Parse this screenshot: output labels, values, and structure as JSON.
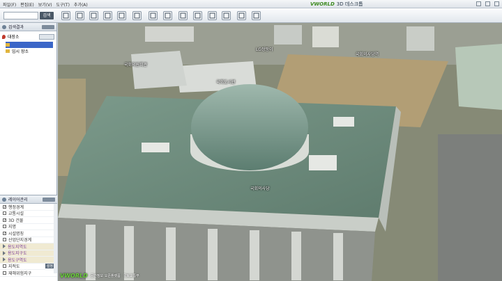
{
  "window": {
    "title": "3D 데스크톱",
    "brand": "WORLD"
  },
  "menu": [
    "파일(F)",
    "편집(E)",
    "보기(V)",
    "도구(T)",
    "추가(A)"
  ],
  "toolbar": {
    "search_placeholder": "",
    "search_button": "검색",
    "tools": [
      "home-icon",
      "measure-icon",
      "terrain-icon",
      "building-icon",
      "house-icon",
      "globe-icon",
      "table-icon",
      "image-icon",
      "chart-icon",
      "bookmark-icon",
      "eye-icon",
      "print-icon",
      "document-icon",
      "refresh-icon"
    ]
  },
  "search_panel": {
    "header": "검색결과",
    "tab_label": "대장소",
    "tree": [
      {
        "label": "",
        "selected": true
      },
      {
        "label": "임시 장소",
        "selected": false
      }
    ]
  },
  "layer_panel": {
    "header": "레이어관리",
    "items": [
      {
        "label": "행정경계",
        "checked": true,
        "group": false
      },
      {
        "label": "교통시설",
        "checked": false,
        "group": false
      },
      {
        "label": "3D 건물",
        "checked": true,
        "group": false
      },
      {
        "label": "지명",
        "checked": false,
        "group": false
      },
      {
        "label": "시설명칭",
        "checked": true,
        "group": false
      },
      {
        "label": "산업단지경계",
        "checked": false,
        "group": false
      },
      {
        "label": "용도지역도",
        "checked": false,
        "group": true
      },
      {
        "label": "용도지구도",
        "checked": false,
        "group": true
      },
      {
        "label": "용도구역도",
        "checked": false,
        "group": true
      },
      {
        "label": "지적도",
        "checked": false,
        "group": false,
        "button": "설정"
      },
      {
        "label": "재해위험지구",
        "checked": false,
        "group": false
      }
    ]
  },
  "map": {
    "labels": {
      "top": "LG쌍둥이",
      "upper_left": "국회의원회관",
      "center_left": "국회도서관",
      "right": "국회의사당역",
      "building": "국회의사당"
    },
    "footer": {
      "logo": "WORLD",
      "text1": "공간정보 오픈플랫폼",
      "text2": "국토교통부"
    }
  },
  "colors": {
    "accent": "#3b66c8",
    "roof": "#6f8e7e",
    "dome": "#6f9585",
    "brand_green": "#3d8a1f"
  }
}
